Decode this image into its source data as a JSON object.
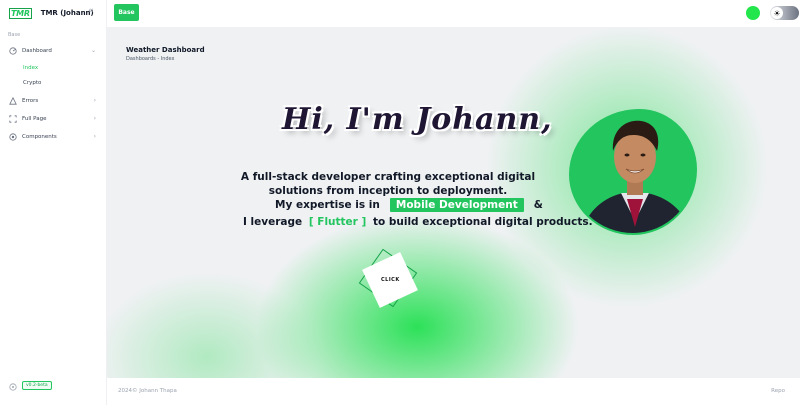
{
  "brand": {
    "logo": "TMR",
    "name": "TMR (Johann)"
  },
  "sidebar": {
    "section": "Base",
    "items": [
      {
        "label": "Dashboard",
        "icon": "dashboard-icon",
        "expanded": true
      },
      {
        "label": "Errors",
        "icon": "warning-icon"
      },
      {
        "label": "Full Page",
        "icon": "expand-icon"
      },
      {
        "label": "Components",
        "icon": "components-icon"
      }
    ],
    "sub_items": [
      {
        "label": "Index",
        "active": true
      },
      {
        "label": "Crypto"
      }
    ],
    "version": "v0.2-beta"
  },
  "topbar": {
    "base_label": "Base"
  },
  "main": {
    "title": "Weather Dashboard",
    "breadcrumb": "Dashboards  - Index"
  },
  "hero": {
    "greeting": "Hi, I'm Johann,",
    "intro": "A full-stack developer crafting exceptional digital solutions from inception to deployment.",
    "expertise_prefix": "My expertise is in",
    "expertise": "Mobile Development",
    "amp": "&",
    "leverage_prefix": "I leverage",
    "tech": "[ Flutter ]",
    "leverage_suffix": "to build exceptional digital products.",
    "button": "CLICK"
  },
  "footer": {
    "copyright": "2024©   Johann Thapa",
    "repo": "Repo"
  },
  "colors": {
    "accent": "#22c55e",
    "status_dot": "#22e64b"
  }
}
